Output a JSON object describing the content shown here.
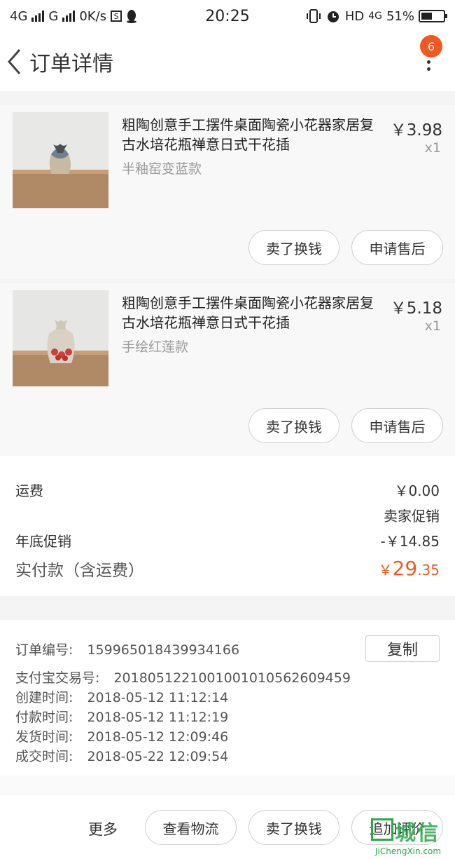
{
  "status_bar": {
    "network1": "4G",
    "network2": "G",
    "speed": "0K/s",
    "time": "20:25",
    "hd": "HD",
    "network3": "4G",
    "battery": "51%",
    "battery_level": 0.51
  },
  "header": {
    "title": "订单详情",
    "badge": "6"
  },
  "items": [
    {
      "title": "粗陶创意手工摆件桌面陶瓷小花器家居复古水培花瓶禅意日式干花插",
      "sku": "半釉窑变蓝款",
      "price": "￥3.98",
      "qty": "x1",
      "sell_label": "卖了换钱",
      "aftersale_label": "申请售后"
    },
    {
      "title": "粗陶创意手工摆件桌面陶瓷小花器家居复古水培花瓶禅意日式干花插",
      "sku": "手绘红莲款",
      "price": "￥5.18",
      "qty": "x1",
      "sell_label": "卖了换钱",
      "aftersale_label": "申请售后"
    }
  ],
  "fees": {
    "shipping_label": "运费",
    "shipping_value": "￥0.00",
    "seller_promo": "卖家促销",
    "promo_label": "年底促销",
    "promo_value": "-￥14.85",
    "total_label": "实付款（含运费）",
    "total_currency": "￥",
    "total_int": "29",
    "total_dec": ".35"
  },
  "order_info": {
    "order_no_label": "订单编号:",
    "order_no": "159965018439934166",
    "copy_label": "复制",
    "alipay_label": "支付宝交易号:",
    "alipay_no": "2018051221001001010562609459",
    "created_label": "创建时间:",
    "created": "2018-05-12 11:12:14",
    "paid_label": "付款时间:",
    "paid": "2018-05-12 11:12:19",
    "shipped_label": "发货时间:",
    "shipped": "2018-05-12 12:09:46",
    "done_label": "成交时间:",
    "done": "2018-05-22 12:09:54"
  },
  "bottom_bar": {
    "more": "更多",
    "logistics": "查看物流",
    "sell": "卖了换钱",
    "review": "追加评价"
  },
  "watermark": {
    "text": "城信",
    "sub": "JiChengXin.com"
  },
  "colors": {
    "accent": "#f05a22",
    "watermark": "#2aa84a"
  }
}
